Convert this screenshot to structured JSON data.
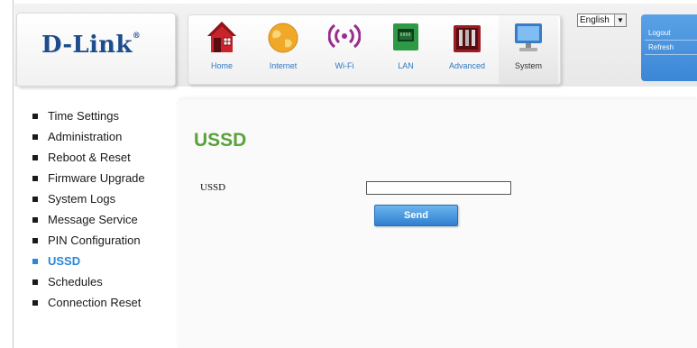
{
  "brand": {
    "logo_text": "D-Link",
    "logo_mark": "®"
  },
  "nav": {
    "items": [
      {
        "label": "Home",
        "icon": "home-icon"
      },
      {
        "label": "Internet",
        "icon": "globe-icon"
      },
      {
        "label": "Wi-Fi",
        "icon": "wifi-icon"
      },
      {
        "label": "LAN",
        "icon": "lan-port-icon"
      },
      {
        "label": "Advanced",
        "icon": "toolbox-icon"
      },
      {
        "label": "System",
        "icon": "computer-icon"
      }
    ],
    "active": "System"
  },
  "language": {
    "selected": "English"
  },
  "account": {
    "logout": "Logout",
    "refresh": "Refresh"
  },
  "sidebar": {
    "items": [
      {
        "label": "Time Settings"
      },
      {
        "label": "Administration"
      },
      {
        "label": "Reboot & Reset"
      },
      {
        "label": "Firmware Upgrade"
      },
      {
        "label": "System Logs"
      },
      {
        "label": "Message Service"
      },
      {
        "label": "PIN Configuration"
      },
      {
        "label": "USSD"
      },
      {
        "label": "Schedules"
      },
      {
        "label": "Connection Reset"
      }
    ],
    "active": "USSD"
  },
  "main": {
    "title": "USSD",
    "field_label": "USSD",
    "ussd_value": "",
    "send_label": "Send"
  },
  "colors": {
    "accent_blue": "#2a86d8",
    "title_green": "#5aa23a",
    "logo_blue": "#1e4d8c"
  }
}
